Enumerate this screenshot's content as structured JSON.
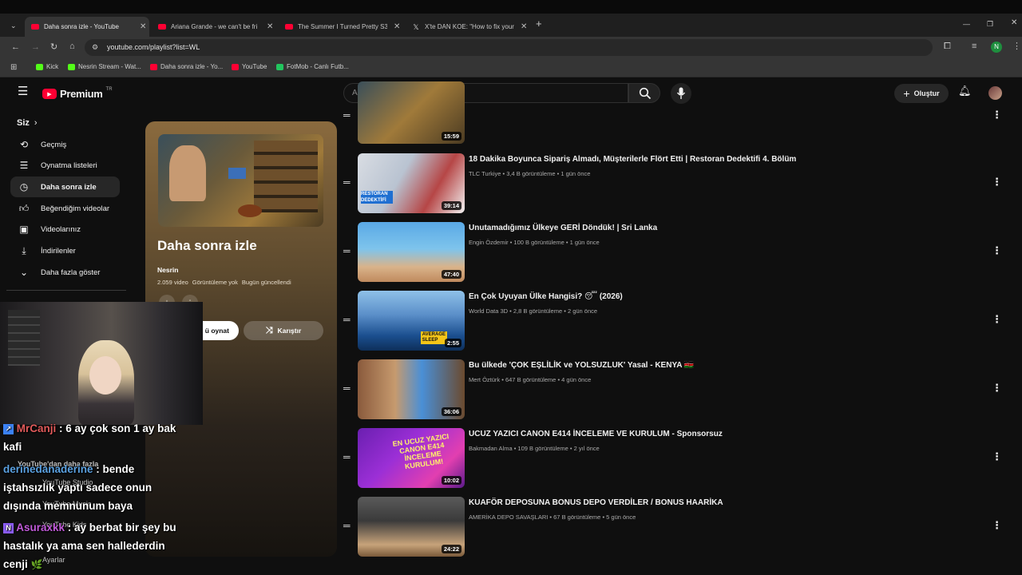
{
  "browser": {
    "tabs": [
      {
        "title": "Daha sonra izle - YouTube",
        "icon": "youtube-favicon",
        "active": true
      },
      {
        "title": "Ariana Grande - we can't be fri",
        "icon": "youtube-favicon",
        "active": false
      },
      {
        "title": "The Summer I Turned Pretty S3",
        "icon": "youtube-favicon",
        "active": false
      },
      {
        "title": "X'te DAN KOE: \"How to fix your",
        "icon": "x-favicon",
        "active": false
      }
    ],
    "url": "youtube.com/playlist?list=WL",
    "profile_initial": "N",
    "bookmarks": [
      {
        "label": "Kick",
        "color": "#53fc18"
      },
      {
        "label": "Nesrin Stream - Wat...",
        "color": "#53fc18"
      },
      {
        "label": "Daha sonra izle - Yo...",
        "color": "#ff0033"
      },
      {
        "label": "YouTube",
        "color": "#ff0033"
      },
      {
        "label": "FotMob - Canlı Futb...",
        "color": "#22c55e"
      }
    ]
  },
  "youtube": {
    "logo_text": "Premium",
    "logo_badge": "TR",
    "search_placeholder": "Ara",
    "create_label": "Oluştur",
    "sidebar": {
      "section_title": "Siz",
      "items": [
        {
          "label": "Geçmiş",
          "icon": "history-icon"
        },
        {
          "label": "Oynatma listeleri",
          "icon": "playlists-icon"
        },
        {
          "label": "Daha sonra izle",
          "icon": "clock-icon"
        },
        {
          "label": "Beğendiğim videolar",
          "icon": "like-icon"
        },
        {
          "label": "Videolarınız",
          "icon": "video-icon"
        },
        {
          "label": "İndirilenler",
          "icon": "download-icon"
        },
        {
          "label": "Daha fazla göster",
          "icon": "chevron-down-icon"
        }
      ],
      "more_section": "YouTube'dan daha fazla",
      "studio": "YouTube Studio",
      "music": "YouTube Music",
      "kids": "YouTube Kids",
      "settings": "Ayarlar"
    },
    "playlist": {
      "title": "Daha sonra izle",
      "owner": "Nesrin",
      "video_count": "2.059 video",
      "views": "Görüntüleme yok",
      "updated": "Bugün güncellendi",
      "play_all": "Tümünü oynat",
      "play_all_visible": "ü oynat",
      "shuffle": "Karıştır"
    },
    "videos": [
      {
        "title": "",
        "channel": "",
        "views": "",
        "age": "",
        "duration": "15:59"
      },
      {
        "title": "18 Dakika Boyunca Sipariş Almadı, Müşterilerle Flört Etti | Restoran Dedektifi 4. Bölüm",
        "channel": "TLC Turkiye",
        "views": "3,4 B görüntüleme",
        "age": "1 gün önce",
        "duration": "39:14"
      },
      {
        "title": "Unutamadığımız Ülkeye GERİ Döndük! | Sri Lanka",
        "channel": "Engin Özdemir",
        "views": "100 B görüntüleme",
        "age": "1 gün önce",
        "duration": "47:40"
      },
      {
        "title": "En Çok Uyuyan Ülke Hangisi? 😴 (2026)",
        "channel": "World Data 3D",
        "views": "2,8 B görüntüleme",
        "age": "2 gün önce",
        "duration": "2:55"
      },
      {
        "title": "Bu ülkede 'ÇOK EŞLİLİK ve YOLSUZLUK' Yasal - KENYA 🇰🇪",
        "channel": "Mert Öztürk",
        "views": "647 B görüntüleme",
        "age": "4 gün önce",
        "duration": "36:06"
      },
      {
        "title": "UCUZ YAZICI CANON E414 İNCELEME VE KURULUM - Sponsorsuz",
        "channel": "Bakmadan Alma",
        "views": "109 B görüntüleme",
        "age": "2 yıl önce",
        "duration": "10:02"
      },
      {
        "title": "KUAFÖR DEPOSUNA BONUS DEPO VERDİLER / BONUS HAARİKA",
        "channel": "AMERİKA DEPO SAVAŞLARI",
        "views": "67 B görüntüleme",
        "age": "5 gün önce",
        "duration": "24:22"
      }
    ]
  },
  "stream_overlay": {
    "chat": [
      {
        "user": "MrCanji",
        "user_color": "#e05a5a",
        "text": " : 6 ay çok son 1 ay bak",
        "text2": "kafi"
      },
      {
        "user": "derinedanaderine",
        "user_color": "#5aa0e0",
        "text": " : bende",
        "text2": "iştahsızlık yaptı sadece onun",
        "text3": "dışında memnunum baya"
      },
      {
        "user": "Asuraxkk",
        "user_color": "#c05ad8",
        "text": " : ay berbat bir şey bu",
        "text2": "hastalık ya ama sen hallederdin",
        "text3": "cenji"
      }
    ]
  }
}
